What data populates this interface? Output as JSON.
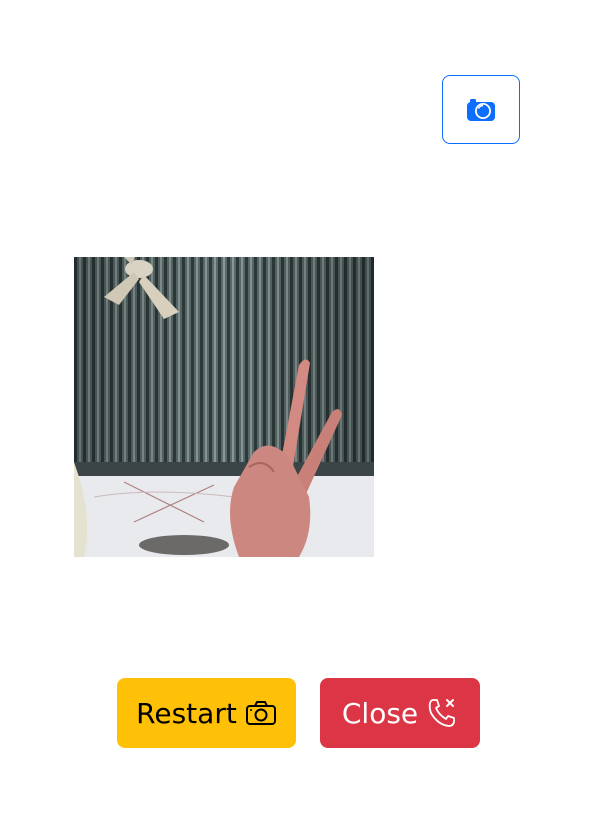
{
  "capture_button": {
    "icon": "camera-fill-icon",
    "color": "#0d6efd"
  },
  "preview": {
    "description_icon": "captured-photo"
  },
  "actions": {
    "restart": {
      "label": "Restart",
      "icon": "camera-icon",
      "color": "#ffc107"
    },
    "close": {
      "label": "Close",
      "icon": "phone-x-icon",
      "color": "#dc3545"
    }
  }
}
